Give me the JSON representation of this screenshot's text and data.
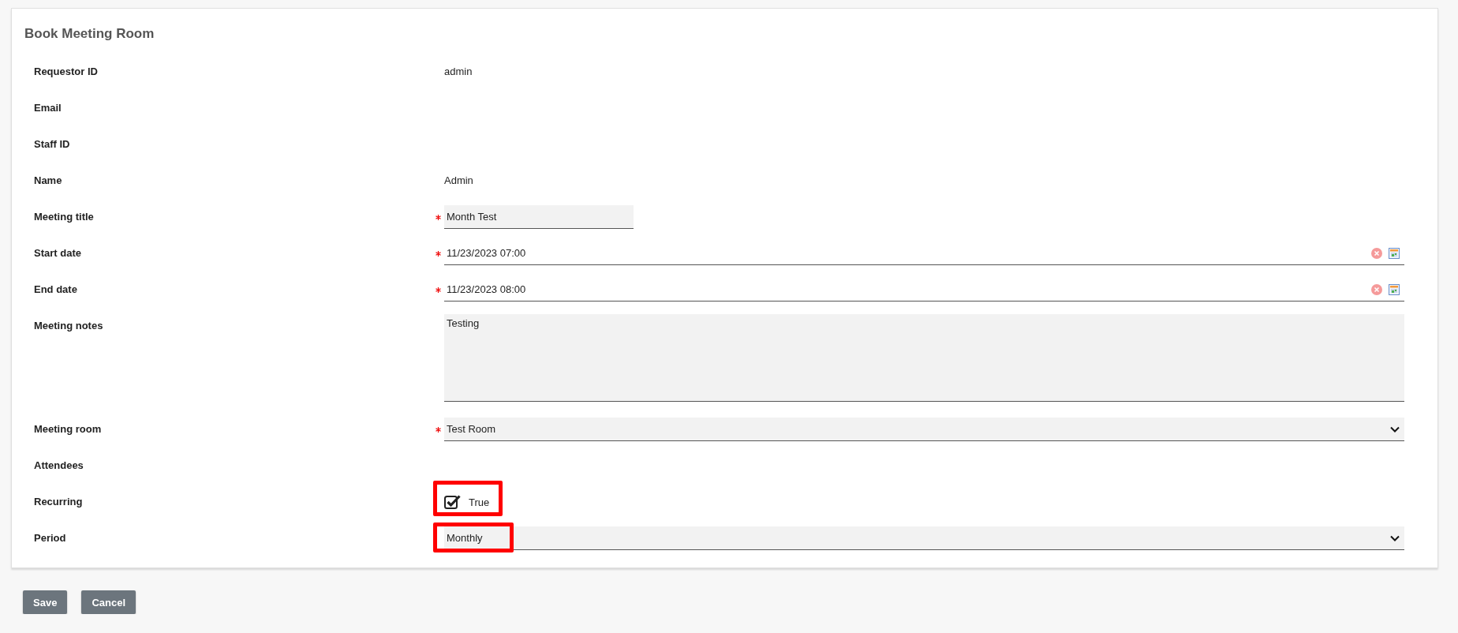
{
  "form": {
    "title": "Book Meeting Room",
    "fields": [
      {
        "kind": "text",
        "label": "Requestor ID",
        "value": "admin",
        "required": false,
        "highlighted": false
      },
      {
        "kind": "text",
        "label": "Email",
        "required": false,
        "highlighted": false
      },
      {
        "kind": "text",
        "label": "Staff ID",
        "required": false,
        "highlighted": false
      },
      {
        "kind": "text",
        "label": "Name",
        "value": "Admin",
        "required": false,
        "highlighted": false
      },
      {
        "kind": "input",
        "label": "Meeting title",
        "value": "Month Test",
        "required": true,
        "highlighted": false
      },
      {
        "kind": "date",
        "label": "Start date",
        "value": "11/23/2023 07:00",
        "required": true,
        "highlighted": false
      },
      {
        "kind": "date",
        "label": "End date",
        "value": "11/23/2023 08:00",
        "required": true,
        "highlighted": false
      },
      {
        "kind": "textarea",
        "label": "Meeting notes",
        "value": "Testing",
        "required": false,
        "highlighted": false
      },
      {
        "kind": "select",
        "label": "Meeting room",
        "value": "Test Room",
        "required": true,
        "highlighted": false
      },
      {
        "kind": "text",
        "label": "Attendees",
        "required": false,
        "highlighted": false
      },
      {
        "kind": "checkbox",
        "label": "Recurring",
        "value": "True",
        "checked": true,
        "required": false,
        "highlighted": true
      },
      {
        "kind": "select",
        "label": "Period",
        "value": "Monthly",
        "required": false,
        "highlighted": true
      }
    ]
  },
  "buttons": [
    {
      "label": "Save"
    },
    {
      "label": "Cancel"
    }
  ]
}
